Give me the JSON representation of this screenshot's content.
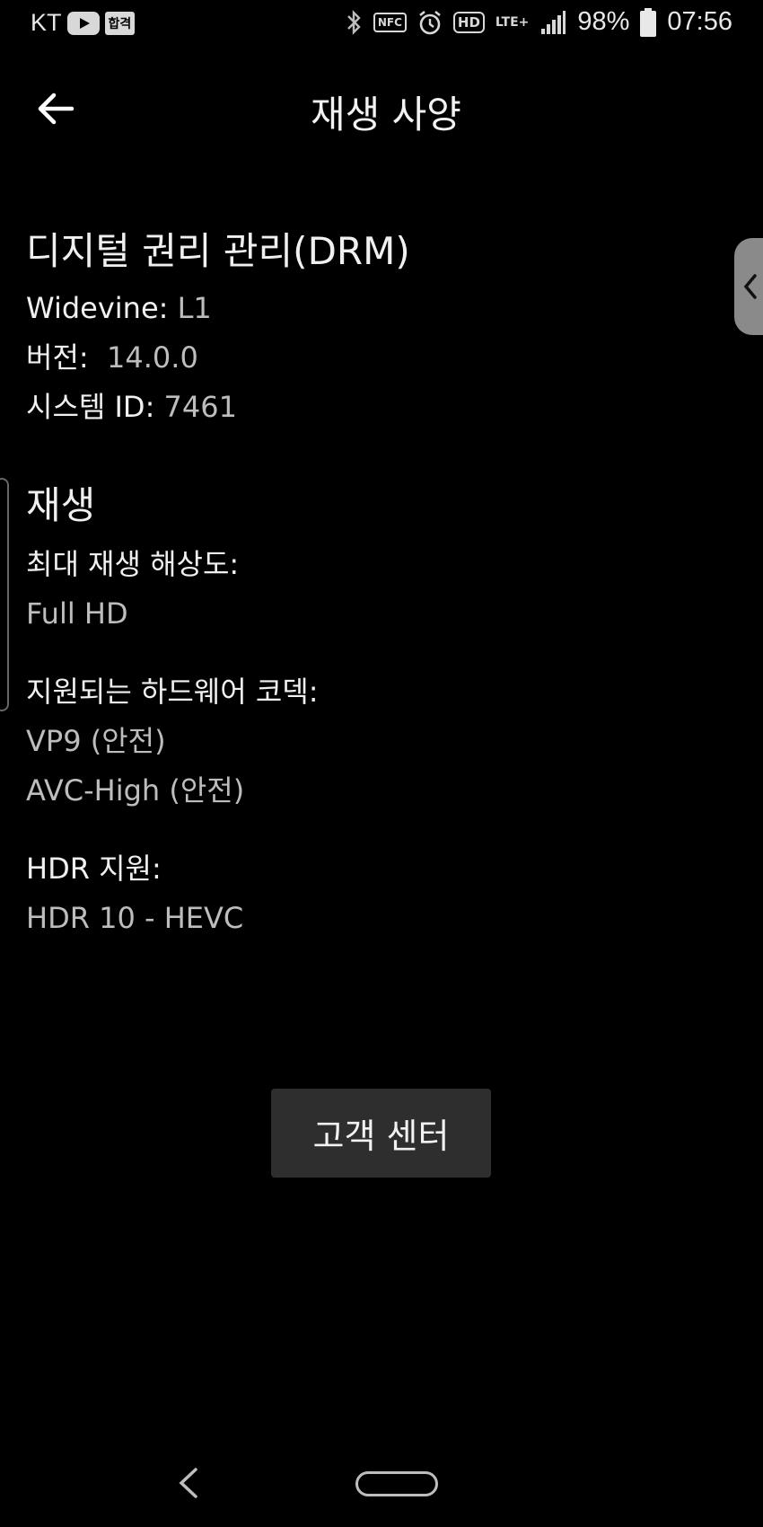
{
  "status_bar": {
    "carrier": "KT",
    "badge_text": "합격",
    "nfc": "NFC",
    "hd": "HD",
    "lte": "LTE+",
    "battery": "98%",
    "time": "07:56"
  },
  "app_bar": {
    "title": "재생 사양"
  },
  "drm": {
    "heading": "디지털 권리 관리(DRM)",
    "widevine_label": "Widevine: ",
    "widevine_value": "L1",
    "version_label": "버전:  ",
    "version_value": "14.0.0",
    "system_id_label": "시스템 ID: ",
    "system_id_value": "7461"
  },
  "playback": {
    "heading": "재생",
    "max_res_label": "최대 재생 해상도:",
    "max_res_value": "Full HD",
    "codecs_label": "지원되는 하드웨어 코덱:",
    "codecs": [
      "VP9 (안전)",
      "AVC-High (안전)"
    ],
    "hdr_label": "HDR 지원:",
    "hdr_value": "HDR 10 - HEVC"
  },
  "help_button": {
    "label": "고객 센터"
  }
}
